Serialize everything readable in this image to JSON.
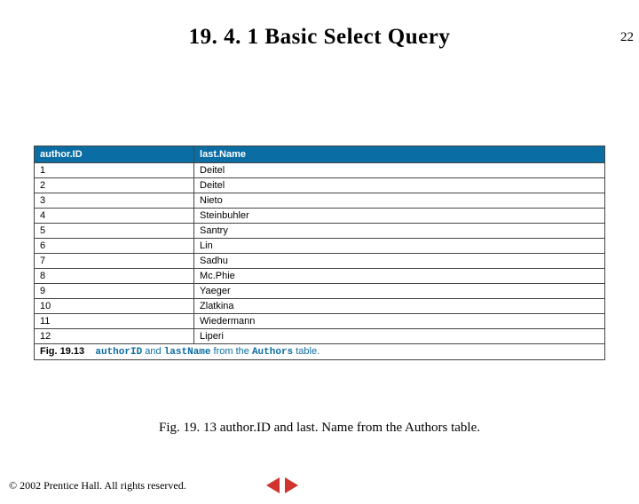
{
  "page_number": "22",
  "title": "19. 4. 1 Basic Select Query",
  "table": {
    "headers": [
      "author.ID",
      "last.Name"
    ],
    "rows": [
      [
        "1",
        "Deitel"
      ],
      [
        "2",
        "Deitel"
      ],
      [
        "3",
        "Nieto"
      ],
      [
        "4",
        "Steinbuhler"
      ],
      [
        "5",
        "Santry"
      ],
      [
        "6",
        "Lin"
      ],
      [
        "7",
        "Sadhu"
      ],
      [
        "8",
        "Mc.Phie"
      ],
      [
        "9",
        "Yaeger"
      ],
      [
        "10",
        "Zlatkina"
      ],
      [
        "11",
        "Wiedermann"
      ],
      [
        "12",
        "Liperi"
      ]
    ],
    "caption_fig": "Fig. 19.13",
    "caption_code1": "authorID",
    "caption_mid": " and ",
    "caption_code2": "lastName",
    "caption_tail": " from the ",
    "caption_code3": "Authors",
    "caption_end": " table."
  },
  "figure_caption": "Fig. 19. 13 author.ID and last. Name from the Authors table.",
  "copyright": "© 2002 Prentice Hall. All rights reserved.",
  "chart_data": {
    "type": "table",
    "title": "authorID and lastName from the Authors table",
    "columns": [
      "author.ID",
      "last.Name"
    ],
    "rows": [
      {
        "author.ID": 1,
        "last.Name": "Deitel"
      },
      {
        "author.ID": 2,
        "last.Name": "Deitel"
      },
      {
        "author.ID": 3,
        "last.Name": "Nieto"
      },
      {
        "author.ID": 4,
        "last.Name": "Steinbuhler"
      },
      {
        "author.ID": 5,
        "last.Name": "Santry"
      },
      {
        "author.ID": 6,
        "last.Name": "Lin"
      },
      {
        "author.ID": 7,
        "last.Name": "Sadhu"
      },
      {
        "author.ID": 8,
        "last.Name": "Mc.Phie"
      },
      {
        "author.ID": 9,
        "last.Name": "Yaeger"
      },
      {
        "author.ID": 10,
        "last.Name": "Zlatkina"
      },
      {
        "author.ID": 11,
        "last.Name": "Wiedermann"
      },
      {
        "author.ID": 12,
        "last.Name": "Liperi"
      }
    ]
  }
}
